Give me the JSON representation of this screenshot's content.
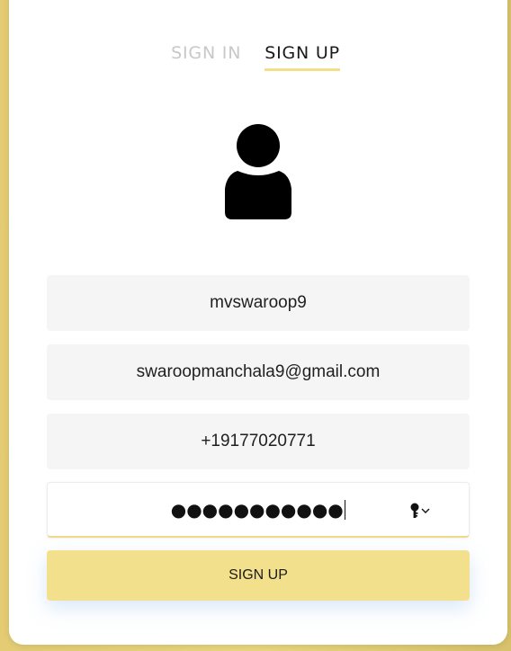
{
  "tabs": {
    "sign_in": "SIGN IN",
    "sign_up": "SIGN UP"
  },
  "form": {
    "username": "mvswaroop9",
    "email": "swaroopmanchala9@gmail.com",
    "phone": "+19177020771",
    "password_masked": "●●●●●●●●●●●"
  },
  "buttons": {
    "sign_up": "SIGN UP"
  },
  "icons": {
    "avatar": "user-silhouette-icon",
    "password_manager": "key-icon",
    "dropdown": "chevron-down-icon"
  },
  "colors": {
    "accent": "#f3e08c",
    "background": "#e6cf78",
    "inactive_tab": "#c8c8c8",
    "field_bg": "#f5f5f5"
  }
}
